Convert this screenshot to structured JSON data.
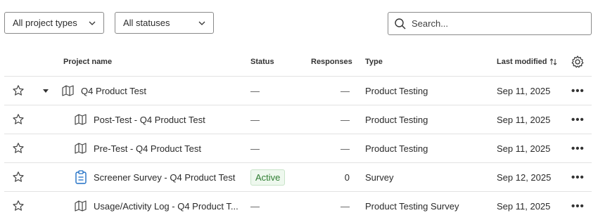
{
  "filters": {
    "project_types": {
      "value": "All project types"
    },
    "statuses": {
      "value": "All statuses"
    }
  },
  "search": {
    "placeholder": "Search..."
  },
  "columns": {
    "project_name": "Project name",
    "status": "Status",
    "responses": "Responses",
    "type": "Type",
    "last_modified": "Last modified"
  },
  "rows": [
    {
      "name": "Q4 Product Test",
      "status": "—",
      "responses": "—",
      "type": "Product Testing",
      "modified": "Sep 11, 2025",
      "icon": "product-test-icon",
      "expandable": true
    },
    {
      "name": "Post-Test - Q4 Product Test",
      "status": "—",
      "responses": "—",
      "type": "Product Testing",
      "modified": "Sep 11, 2025",
      "icon": "product-test-icon"
    },
    {
      "name": "Pre-Test - Q4 Product Test",
      "status": "—",
      "responses": "—",
      "type": "Product Testing",
      "modified": "Sep 11, 2025",
      "icon": "product-test-icon"
    },
    {
      "name": "Screener Survey - Q4 Product Test",
      "status": "Active",
      "responses": "0",
      "type": "Survey",
      "modified": "Sep 12, 2025",
      "icon": "survey-icon"
    },
    {
      "name": "Usage/Activity Log - Q4 Product T...",
      "status": "—",
      "responses": "—",
      "type": "Product Testing Survey",
      "modified": "Sep 11, 2025",
      "icon": "product-test-icon"
    }
  ],
  "row_more": "•••",
  "colors": {
    "active_badge_text": "#2f7d32",
    "active_badge_bg": "#eef8ee",
    "survey_icon": "#1f6fc5"
  }
}
